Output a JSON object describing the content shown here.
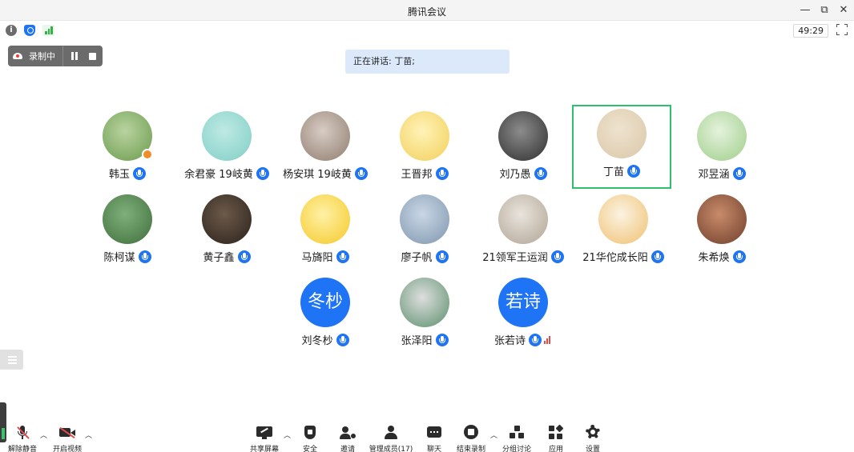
{
  "window": {
    "title": "腾讯会议",
    "controls": {
      "minimize": "—",
      "restore": "⧉",
      "close": "✕"
    }
  },
  "status": {
    "info_glyph": "i",
    "timer": "49:29"
  },
  "recording": {
    "label": "录制中"
  },
  "speaking_banner": "正在讲话: 丁苗;",
  "participants": [
    {
      "name": "韩玉",
      "avatar_text": "",
      "avatar_colors": [
        "#b9d3a0",
        "#6a9b4c"
      ],
      "host": true
    },
    {
      "name": "余君豪 19岐黄",
      "avatar_text": "",
      "avatar_colors": [
        "#bfe9e4",
        "#7fcfc6"
      ]
    },
    {
      "name": "杨安琪 19岐黄",
      "avatar_text": "",
      "avatar_colors": [
        "#d8ccc4",
        "#8f7c6e"
      ]
    },
    {
      "name": "王晋邦",
      "avatar_text": "",
      "avatar_colors": [
        "#fff3b8",
        "#f2cf5a"
      ]
    },
    {
      "name": "刘乃愚",
      "avatar_text": "",
      "avatar_colors": [
        "#8c8c8c",
        "#2e2e2e"
      ]
    },
    {
      "name": "丁苗",
      "avatar_text": "",
      "avatar_colors": [
        "#efe3cf",
        "#d9c7a8"
      ],
      "active": true
    },
    {
      "name": "邓昱涵",
      "avatar_text": "",
      "avatar_colors": [
        "#e4f2dc",
        "#9fce8a"
      ]
    },
    {
      "name": "陈柯谋",
      "avatar_text": "",
      "avatar_colors": [
        "#7fb07a",
        "#3f6e3c"
      ]
    },
    {
      "name": "黄子鑫",
      "avatar_text": "",
      "avatar_colors": [
        "#6d5a4a",
        "#2a211b"
      ]
    },
    {
      "name": "马旖阳",
      "avatar_text": "",
      "avatar_colors": [
        "#fff1a6",
        "#f5c928"
      ]
    },
    {
      "name": "廖子帆",
      "avatar_text": "",
      "avatar_colors": [
        "#c9d7e6",
        "#7f95ad"
      ]
    },
    {
      "name": "21领军王运润",
      "avatar_text": "",
      "avatar_colors": [
        "#e9e4dc",
        "#b0a495"
      ]
    },
    {
      "name": "21华佗成长阳",
      "avatar_text": "",
      "avatar_colors": [
        "#fbf3e2",
        "#f0c070"
      ]
    },
    {
      "name": "朱希焕",
      "avatar_text": "",
      "avatar_colors": [
        "#c98b6b",
        "#6e3f2b"
      ]
    },
    {
      "name": "刘冬杪",
      "avatar_text": "冬杪"
    },
    {
      "name": "张泽阳",
      "avatar_text": "",
      "avatar_colors": [
        "#dedede",
        "#5a8f6c"
      ]
    },
    {
      "name": "张若诗",
      "avatar_text": "若诗",
      "level": true
    }
  ],
  "toolbar": {
    "unmute": "解除静音",
    "video": "开启视频",
    "share": "共享屏幕",
    "security": "安全",
    "invite": "邀请",
    "members": "管理成员(17)",
    "chat": "聊天",
    "end_recording": "结束录制",
    "breakout": "分组讨论",
    "apps": "应用",
    "settings": "设置"
  },
  "colors": {
    "accent": "#1e74f5",
    "active_border": "#2fbf71",
    "banner": "#dbe9fb"
  }
}
